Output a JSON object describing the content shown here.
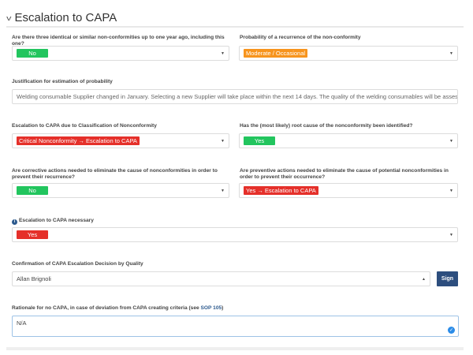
{
  "section": {
    "title": "Escalation to CAPA"
  },
  "fields": {
    "identical_nc": {
      "label": "Are there three identical or similar non-conformities up to one year ago, including this one?",
      "value": "No"
    },
    "probability": {
      "label": "Probability of a recurrence of the non-conformity",
      "value": "Moderate / Occasional"
    },
    "justification": {
      "label": "Justification for estimation of probability",
      "value": "Welding consumable Supplier changed in January. Selecting a new Supplier will take place within the next 14 days. The quality of the welding consumables will be assessed."
    },
    "classification": {
      "label": "Escalation to CAPA due to Classification of Nonconformity",
      "value": "Critical Nonconformity → Escalation to CAPA"
    },
    "root_cause": {
      "label": "Has the (most likely) root cause of the nonconformity been identified?",
      "value": "Yes"
    },
    "corrective": {
      "label": "Are corrective actions needed to eliminate the cause of nonconformities in order to prevent their recurrence?",
      "value": "No"
    },
    "preventive": {
      "label": "Are preventive actions needed to eliminate the cause of potential nonconformities in order to prevent their occurrence?",
      "value": "Yes → Escalation to CAPA"
    },
    "necessary": {
      "label": "Escalation to CAPA necessary",
      "value": "Yes"
    },
    "confirmation": {
      "label": "Confirmation of CAPA Escalation Decision by Quality",
      "value": "Allan Brignoli",
      "button": "Sign"
    },
    "rationale": {
      "label_prefix": "Rationale for no CAPA, in case of deviation from CAPA creating criteria (see ",
      "label_link": "SOP 105",
      "label_suffix": ")",
      "value": "N/A"
    }
  },
  "colors": {
    "green": "#22c55e",
    "orange": "#f7941d",
    "red": "#e5302a",
    "sign": "#2d4e7e"
  }
}
